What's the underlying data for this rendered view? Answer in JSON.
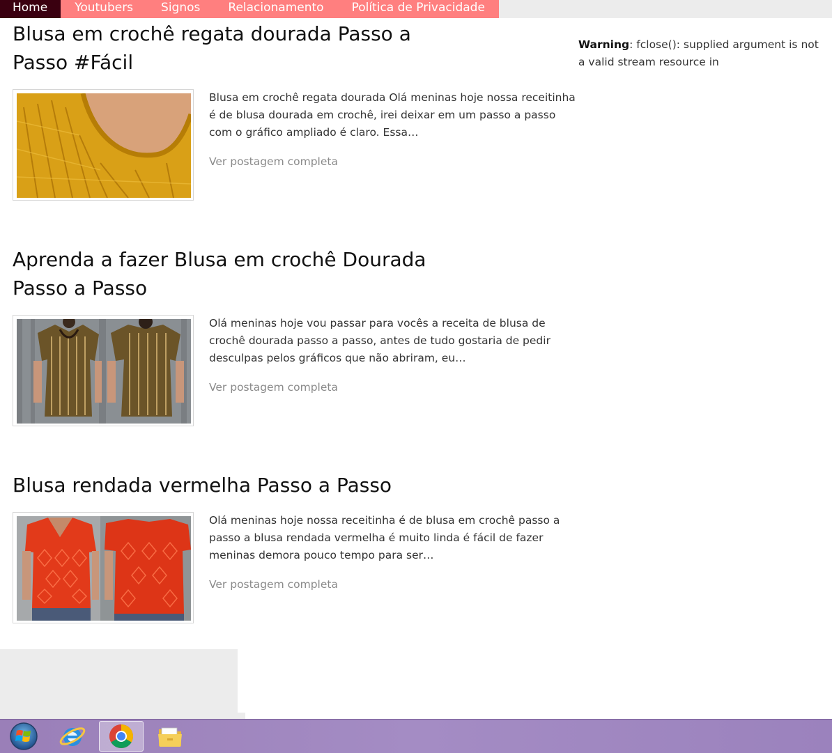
{
  "nav": {
    "items": [
      {
        "label": "Home",
        "active": true
      },
      {
        "label": "Youtubers",
        "active": false
      },
      {
        "label": "Signos",
        "active": false
      },
      {
        "label": "Relacionamento",
        "active": false
      },
      {
        "label": "Política de Privacidade",
        "active": false
      }
    ],
    "colors": {
      "bar": "#ff7f7f",
      "active": "#3a0010"
    }
  },
  "posts": [
    {
      "title": "Blusa em crochê regata dourada Passo a Passo #Fácil",
      "excerpt": "Blusa em crochê regata dourada Olá meninas hoje nossa receitinha é de blusa dourada em crochê, irei deixar em um passo a passo com o gráfico ampliado é claro. Essa…",
      "read_more": "Ver postagem completa",
      "thumbnail": "golden crochet tank top"
    },
    {
      "title": "Aprenda a fazer Blusa em crochê Dourada Passo a Passo",
      "excerpt": "Olá meninas hoje vou passar para vocês a receita de blusa de crochê dourada passo a passo, antes de tudo gostaria de pedir desculpas pelos gráficos que não abriram, eu…",
      "read_more": "Ver postagem completa",
      "thumbnail": "golden crochet blouse front and back"
    },
    {
      "title": "Blusa rendada vermelha Passo a Passo",
      "excerpt": "Olá meninas hoje nossa receitinha é de blusa em crochê passo a passo a blusa rendada vermelha é muito linda é fácil de fazer meninas demora pouco tempo para ser…",
      "read_more": "Ver postagem completa",
      "thumbnail": "red lace crochet blouse front and back"
    }
  ],
  "sidebar": {
    "warning_label": "Warning",
    "warning_text": ": fclose(): supplied argument is not a valid stream resource in"
  },
  "taskbar": {
    "items": [
      {
        "icon": "windows-start-icon"
      },
      {
        "icon": "internet-explorer-icon"
      },
      {
        "icon": "chrome-icon",
        "active": true
      },
      {
        "icon": "file-explorer-icon"
      }
    ]
  }
}
